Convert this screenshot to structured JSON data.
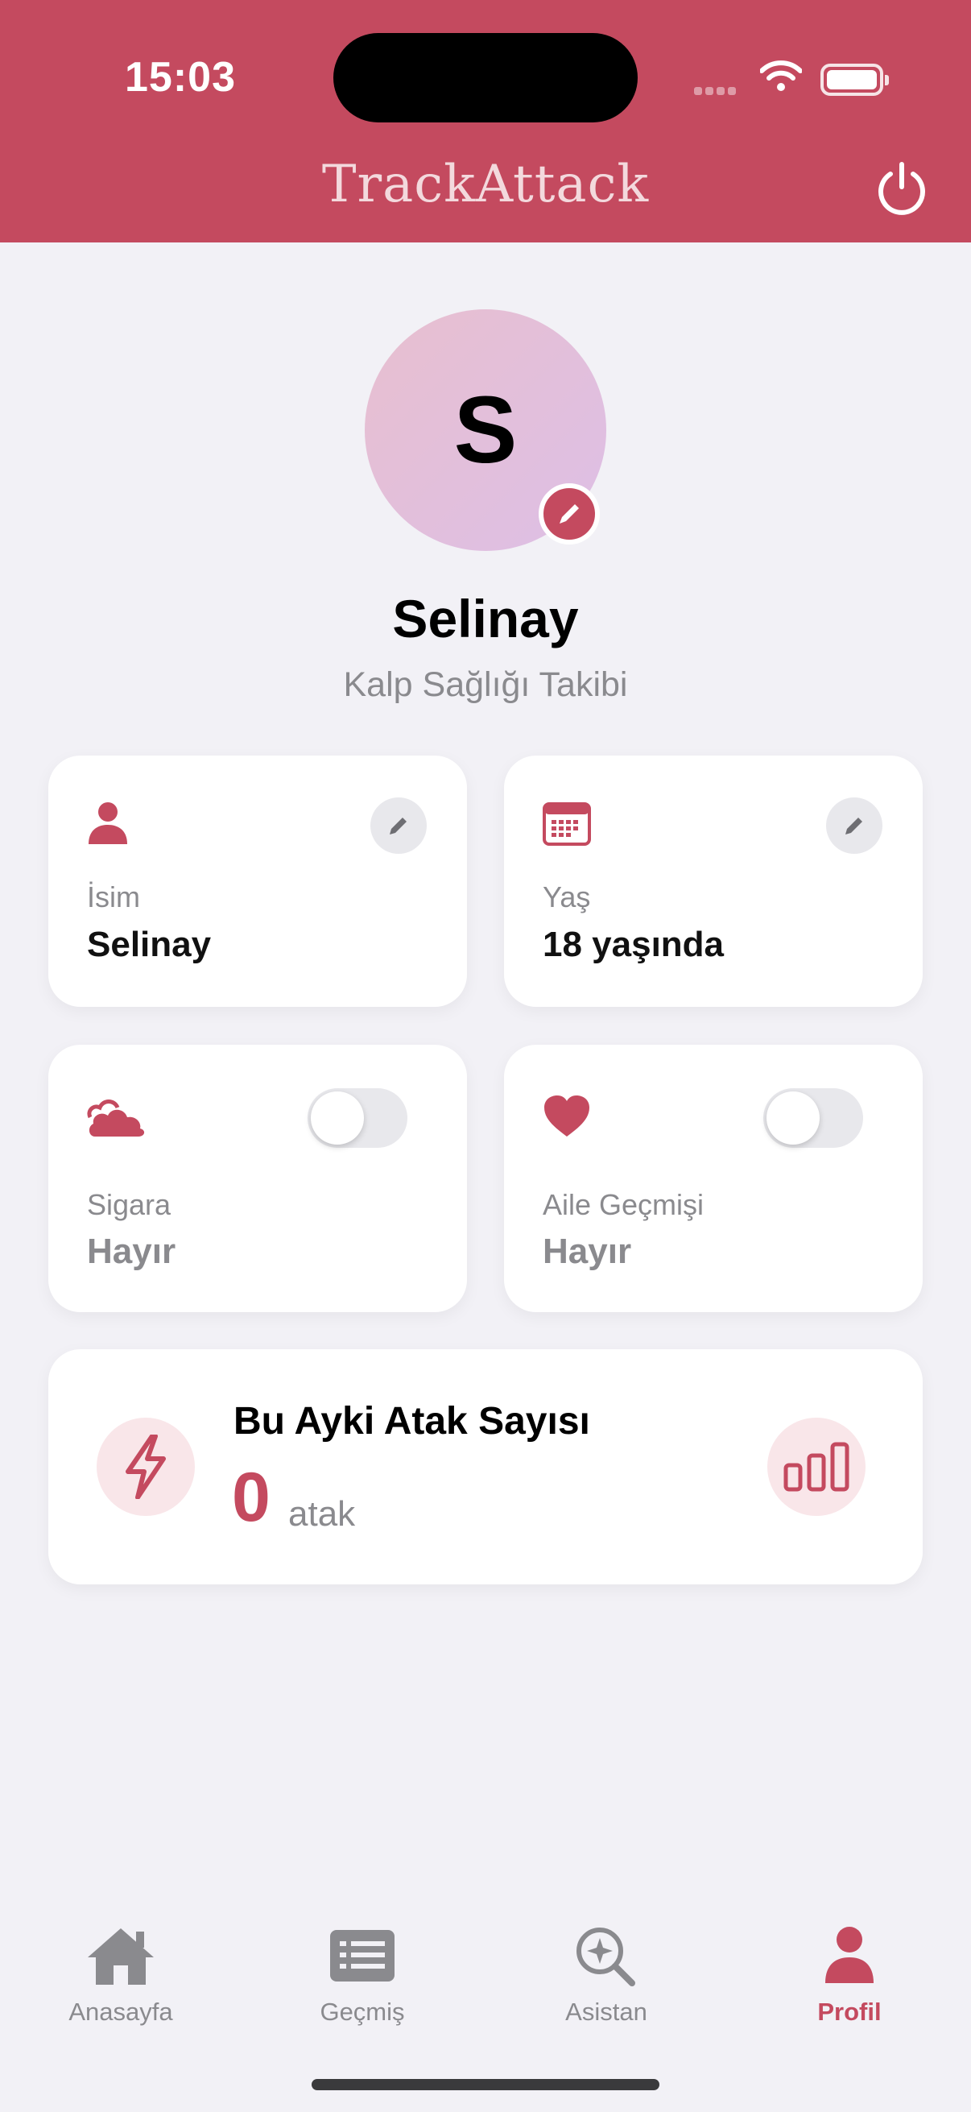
{
  "status_bar": {
    "time": "15:03"
  },
  "header": {
    "title": "TrackAttack",
    "power_icon": "power-icon"
  },
  "profile": {
    "avatar_letter": "S",
    "name": "Selinay",
    "subtitle": "Kalp Sağlığı Takibi"
  },
  "cards": {
    "name": {
      "label": "İsim",
      "value": "Selinay",
      "icon": "person-icon"
    },
    "age": {
      "label": "Yaş",
      "value": "18 yaşında",
      "icon": "calendar-icon"
    },
    "smoking": {
      "label": "Sigara",
      "value": "Hayır",
      "icon": "smoke-icon",
      "toggle_on": false
    },
    "family_history": {
      "label": "Aile Geçmişi",
      "value": "Hayır",
      "icon": "heart-icon",
      "toggle_on": false
    }
  },
  "attack_summary": {
    "title": "Bu Ayki Atak Sayısı",
    "count": "0",
    "unit": "atak"
  },
  "tabbar": {
    "items": [
      {
        "label": "Anasayfa",
        "icon": "home-icon",
        "active": false
      },
      {
        "label": "Geçmiş",
        "icon": "list-icon",
        "active": false
      },
      {
        "label": "Asistan",
        "icon": "sparkle-search-icon",
        "active": false
      },
      {
        "label": "Profil",
        "icon": "person-icon",
        "active": true
      }
    ]
  },
  "colors": {
    "accent": "#C44A5F",
    "background": "#F2F1F6",
    "muted_text": "#8A8A8E"
  }
}
